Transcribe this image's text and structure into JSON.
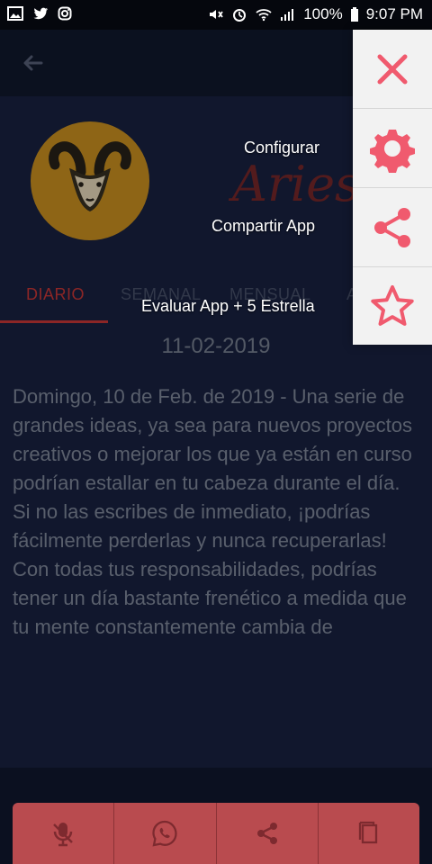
{
  "status_bar": {
    "battery": "100%",
    "time": "9:07 PM"
  },
  "header": {
    "brand": "Aries"
  },
  "tabs": [
    {
      "label": "DIARIO",
      "active": true
    },
    {
      "label": "SEMANAL",
      "active": false
    },
    {
      "label": "MENSUAL",
      "active": false
    },
    {
      "label": "A",
      "active": false
    }
  ],
  "date": "11-02-2019",
  "horoscope_text": "Domingo, 10 de Feb. de 2019 - Una serie de grandes ideas, ya sea para nuevos proyectos creativos o mejorar los que ya están en curso podrían estallar en tu cabeza durante el día. Si no las escribes de inmediato, ¡podrías fácilmente perderlas y nunca recuperarlas! Con todas tus responsabilidades, podrías tener un día bastante frenético a medida que tu mente constantemente cambia de",
  "menu": {
    "close_label": "",
    "configure_label": "Configurar",
    "share_label": "Compartir App",
    "rate_label": "Evaluar App + 5 Estrella"
  },
  "colors": {
    "accent": "#d53a3a",
    "menu_icon": "#f05a6e",
    "background": "#1a2445",
    "avatar": "#d89a22"
  }
}
